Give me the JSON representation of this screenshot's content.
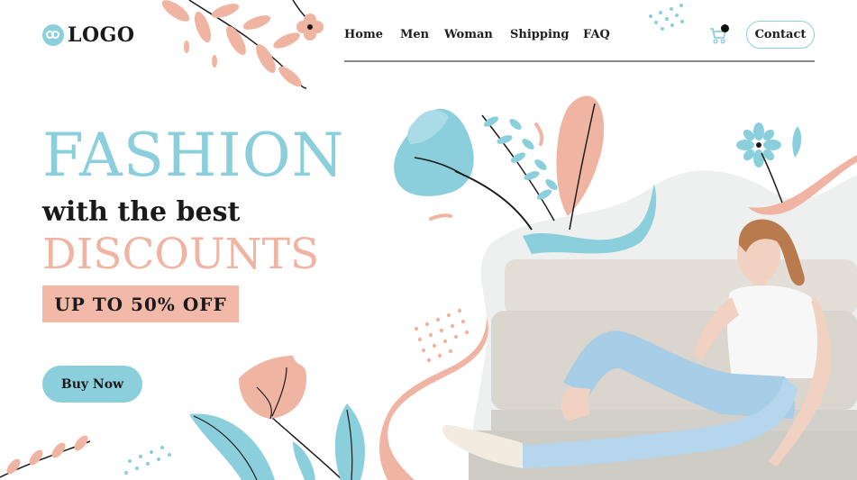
{
  "header": {
    "logo_text": "LOGO",
    "nav": [
      "Home",
      "Men",
      "Woman",
      "Shipping",
      "FAQ"
    ],
    "contact_label": "Contact"
  },
  "hero": {
    "headline": "FASHION",
    "subline": "with the best",
    "highlight": "DISCOUNTS",
    "offer": "UP TO 50% OFF",
    "cta": "Buy Now"
  },
  "icons": {
    "logo": "logo-icon",
    "cart": "cart-icon"
  },
  "colors": {
    "accent_blue": "#8ccfdc",
    "accent_pink": "#f0b4a2",
    "text_dark": "#1a1a1a"
  }
}
